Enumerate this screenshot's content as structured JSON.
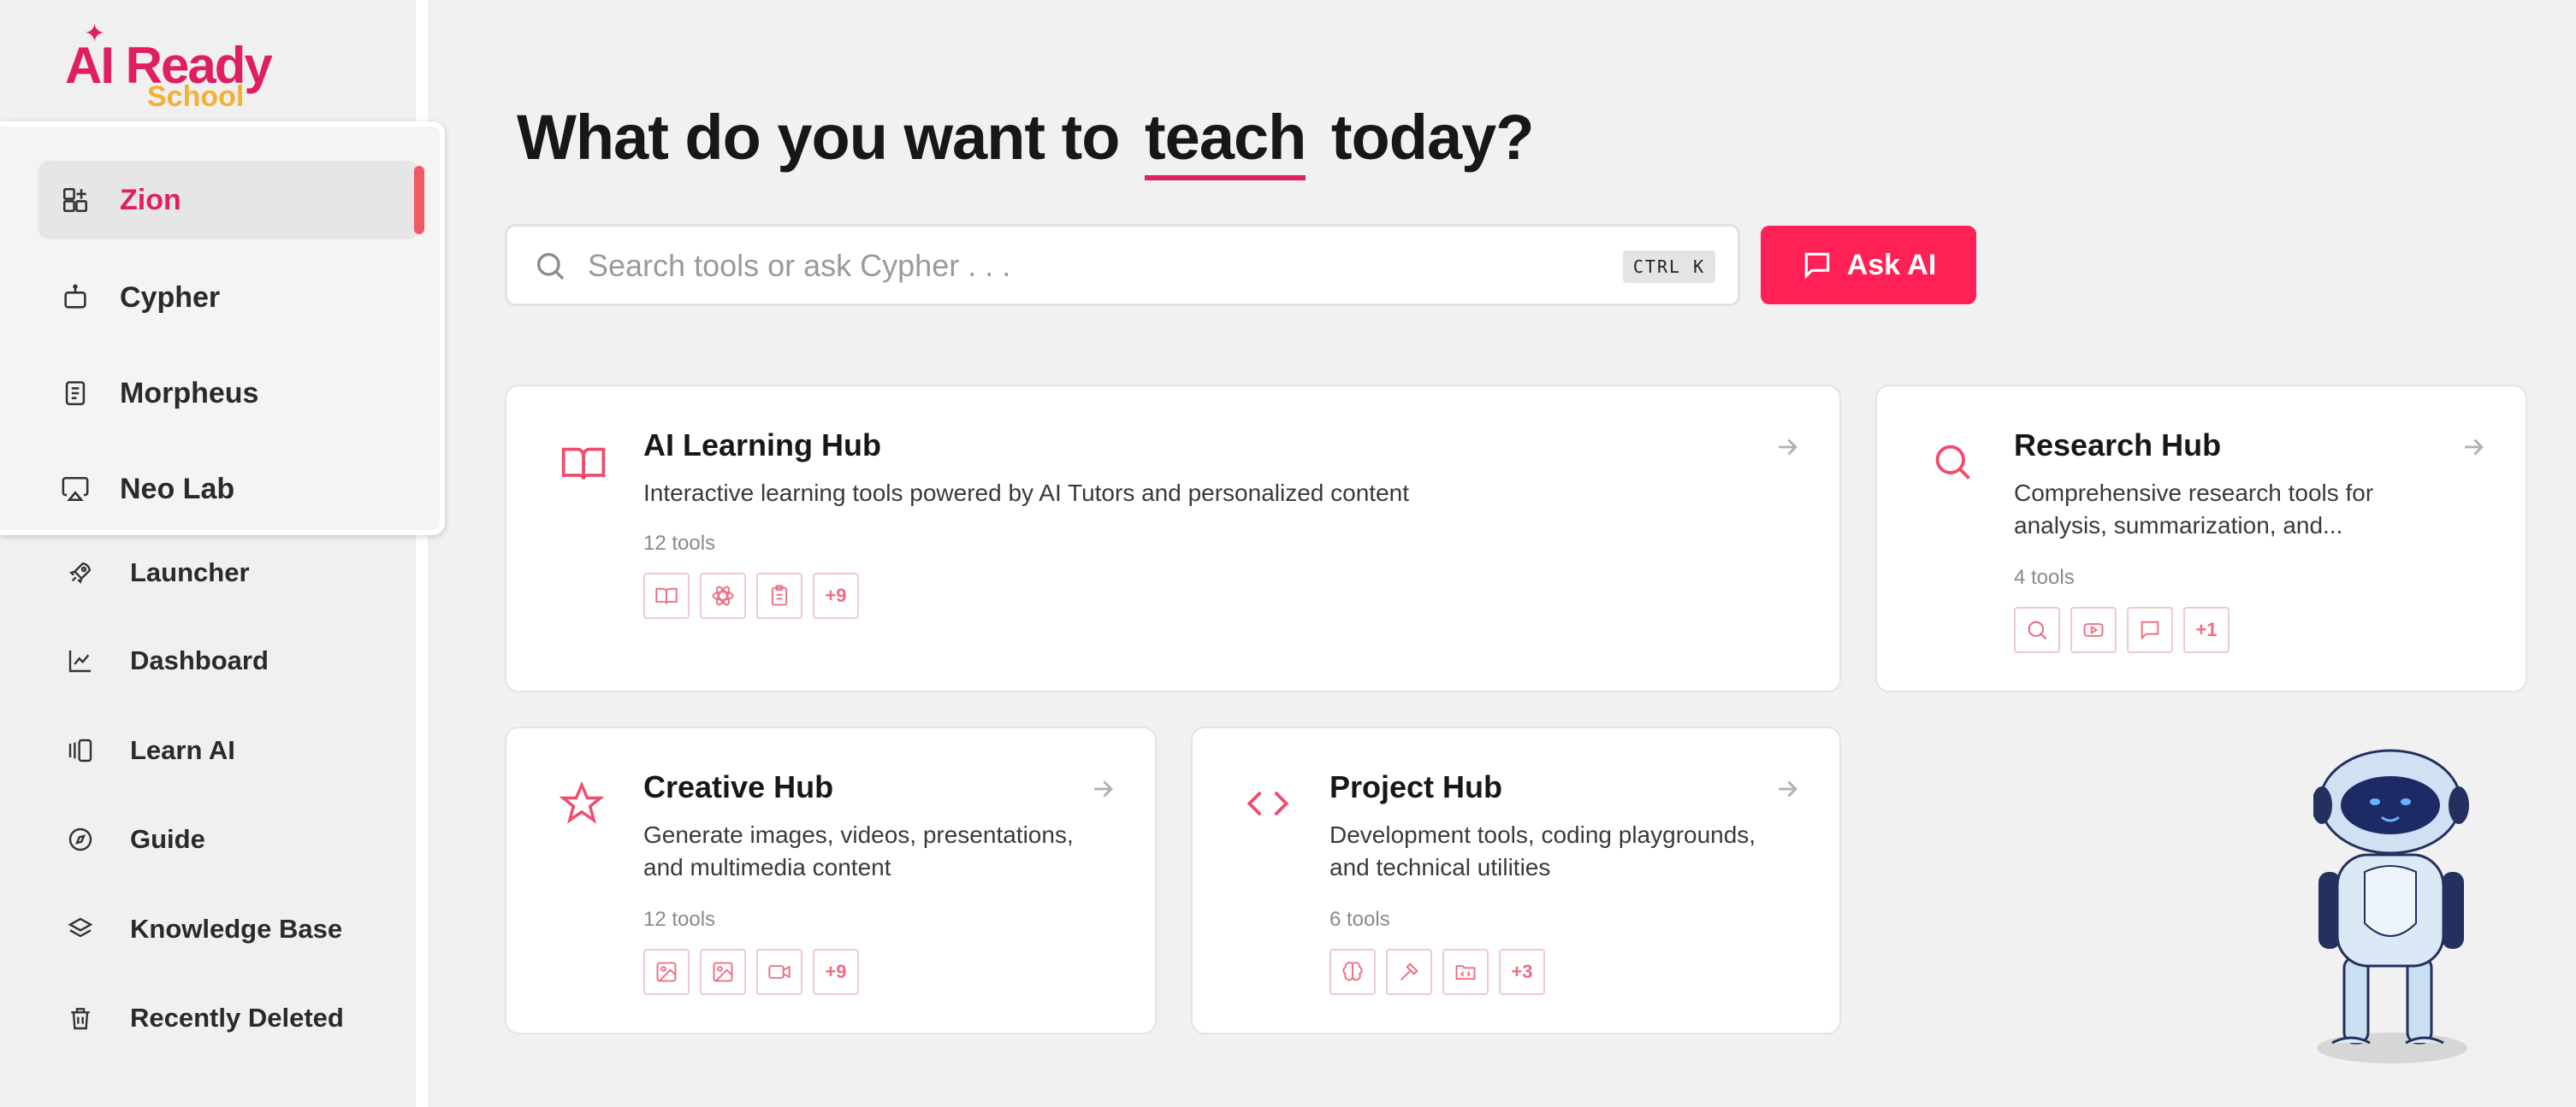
{
  "brand": {
    "name_line1": "AI Ready",
    "name_line2": "School",
    "primary": "#e01e62",
    "accent": "#f2b134",
    "button": "#ff2056"
  },
  "popup_menu": [
    {
      "label": "Zion",
      "icon": "grid-plus-icon",
      "active": true
    },
    {
      "label": "Cypher",
      "icon": "robot-icon"
    },
    {
      "label": "Morpheus",
      "icon": "book-icon"
    },
    {
      "label": "Neo Lab",
      "icon": "airplay-icon"
    }
  ],
  "sidebar": {
    "items": [
      {
        "label": "Launcher",
        "icon": "rocket-icon"
      },
      {
        "label": "Dashboard",
        "icon": "chart-line-icon"
      },
      {
        "label": "Learn AI",
        "icon": "gallery-icon"
      },
      {
        "label": "Guide",
        "icon": "compass-icon"
      },
      {
        "label": "Knowledge Base",
        "icon": "layers-icon"
      },
      {
        "label": "Recently Deleted",
        "icon": "trash-icon"
      }
    ]
  },
  "headline": {
    "before": "What do you want to",
    "highlight": "teach",
    "after": "today?"
  },
  "search": {
    "placeholder": "Search tools or ask Cypher . . .",
    "shortcut": "CTRL K"
  },
  "ask_button": {
    "label": "Ask AI"
  },
  "hubs": [
    {
      "title": "AI Learning Hub",
      "desc": "Interactive learning tools powered by AI Tutors and personalized content",
      "count": "12 tools",
      "more": "+9",
      "icon": "book-open-icon"
    },
    {
      "title": "Research Hub",
      "desc_line1": "Comprehensive research tools for",
      "desc_line2": "analysis, summarization, and...",
      "count": "4 tools",
      "more": "+1",
      "icon": "search-icon"
    },
    {
      "title": "Creative Hub",
      "desc_line1": "Generate images, videos, presentations,",
      "desc_line2": "and multimedia content",
      "count": "12 tools",
      "more": "+9",
      "icon": "star-icon"
    },
    {
      "title": "Project Hub",
      "desc_line1": "Development tools, coding playgrounds,",
      "desc_line2": "and technical utilities",
      "count": "6 tools",
      "more": "+3",
      "icon": "code-icon"
    }
  ]
}
